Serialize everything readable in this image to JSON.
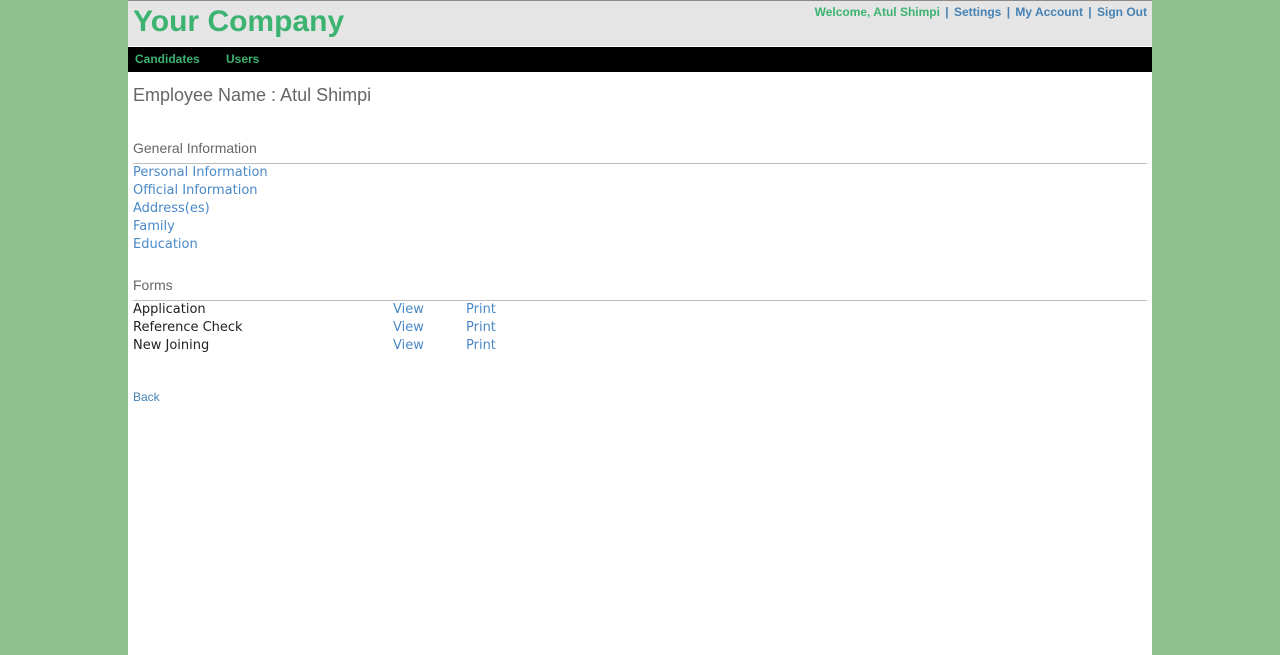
{
  "header": {
    "logo": "Your Company",
    "welcome": "Welcome, Atul Shimpi",
    "separator": "|",
    "links": {
      "settings": "Settings",
      "my_account": "My Account",
      "sign_out": "Sign Out"
    }
  },
  "nav": {
    "candidates": "Candidates",
    "users": "Users"
  },
  "main": {
    "employee_title": "Employee Name : Atul Shimpi",
    "general_information": {
      "heading": "General Information",
      "links": [
        "Personal Information",
        "Official Information",
        "Address(es)",
        "Family",
        "Education"
      ]
    },
    "forms": {
      "heading": "Forms",
      "rows": [
        {
          "name": "Application",
          "view": "View",
          "print": "Print"
        },
        {
          "name": "Reference Check",
          "view": "View",
          "print": "Print"
        },
        {
          "name": "New Joining",
          "view": "View",
          "print": "Print"
        }
      ]
    },
    "back": "Back"
  },
  "colors": {
    "background": "#8fbf8d",
    "brand_green": "#3cb371",
    "link_blue": "#4a89c8",
    "header_gray": "#e5e5e5",
    "navbar": "#000000"
  }
}
